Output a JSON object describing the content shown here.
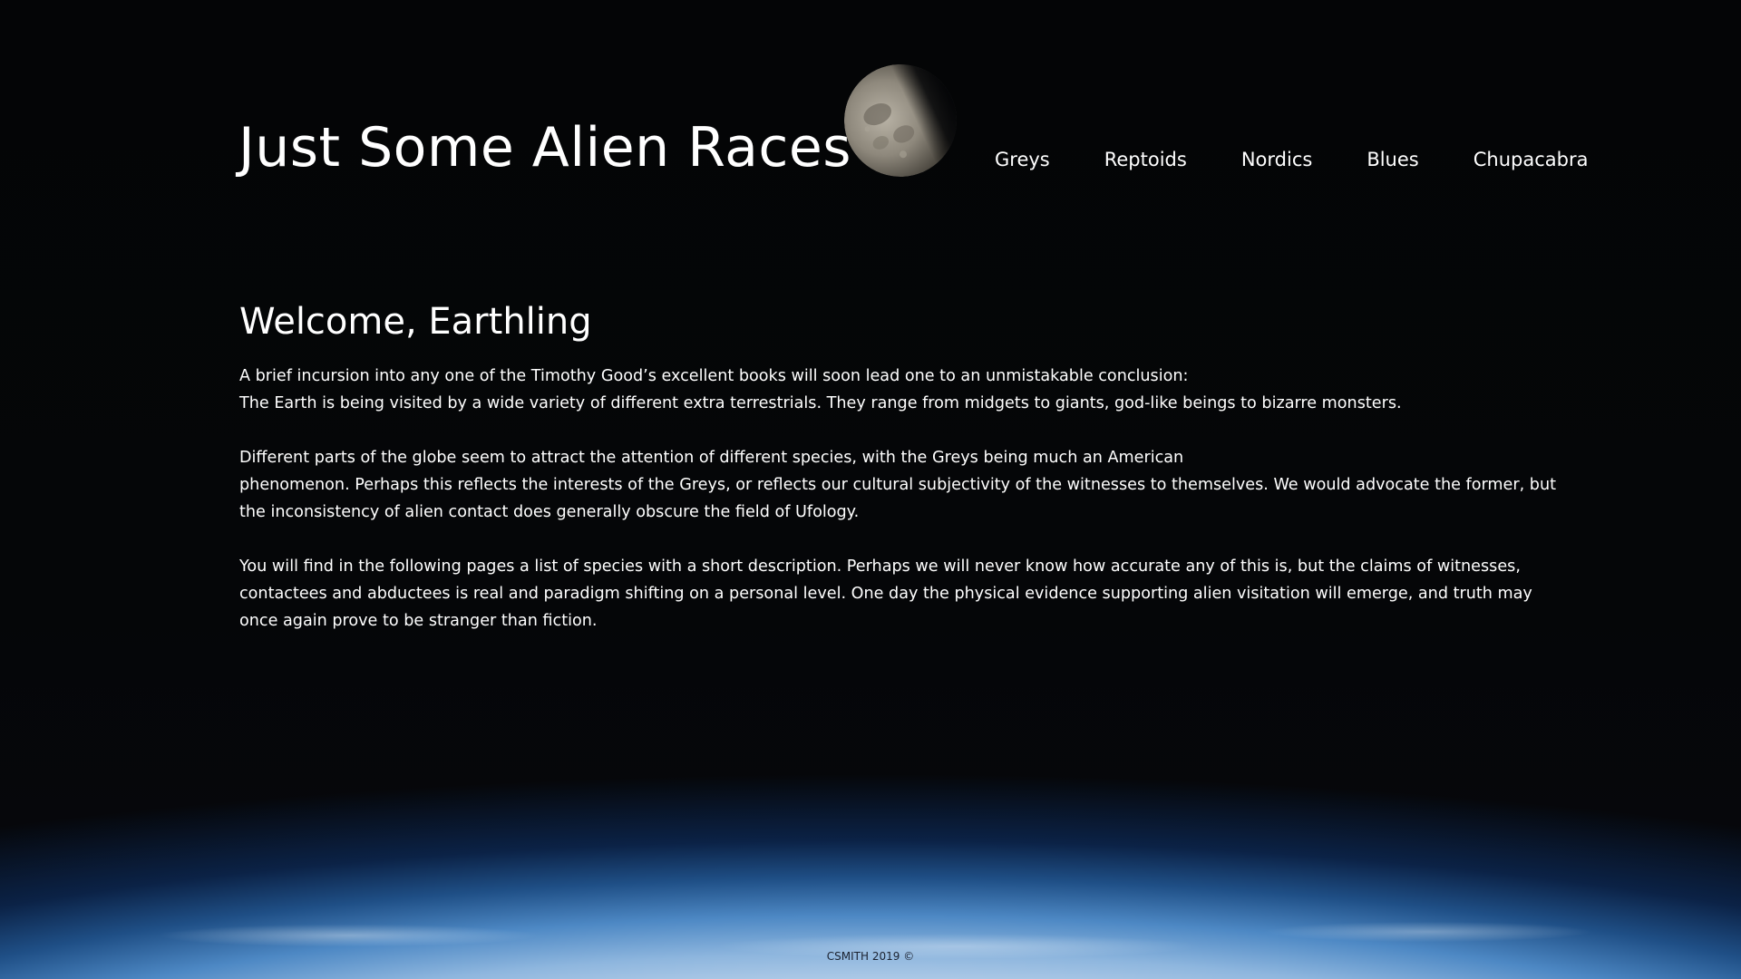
{
  "site": {
    "title": "Just Some Alien Races"
  },
  "nav": {
    "items": [
      {
        "label": "Greys"
      },
      {
        "label": "Reptoids"
      },
      {
        "label": "Nordics"
      },
      {
        "label": "Blues"
      },
      {
        "label": "Chupacabra"
      }
    ]
  },
  "main": {
    "heading": "Welcome, Earthling",
    "paragraphs": [
      {
        "lines": [
          "A brief incursion into any one of the Timothy Good’s excellent books will soon lead one to an unmistakable conclusion:",
          "The Earth is being visited by a wide variety of different extra terrestrials. They range from midgets to giants, god-like beings to bizarre monsters."
        ]
      },
      {
        "lines": [
          "Different parts of the globe seem to attract the attention of different species, with the Greys being much an American",
          "phenomenon. Perhaps this reflects the interests of the Greys, or reflects our cultural subjectivity of the witnesses to themselves. We would advocate the former, but the inconsistency of alien contact does generally obscure the field of Ufology."
        ]
      },
      {
        "lines": [
          "You will find in the following pages a list of species with a short description. Perhaps we will never know how accurate any of this is, but the claims of witnesses, contactees and abductees is real and paradigm shifting on a personal level. One day the physical evidence supporting alien visitation will emerge, and truth may once again prove to be stranger than fiction."
        ]
      }
    ]
  },
  "footer": {
    "text": "CSMITH 2019 ©"
  },
  "colors": {
    "background": "#030406",
    "text": "#ffffff",
    "earth_glow": "#4d88c4"
  },
  "icons": {
    "moon": "moon-image"
  }
}
